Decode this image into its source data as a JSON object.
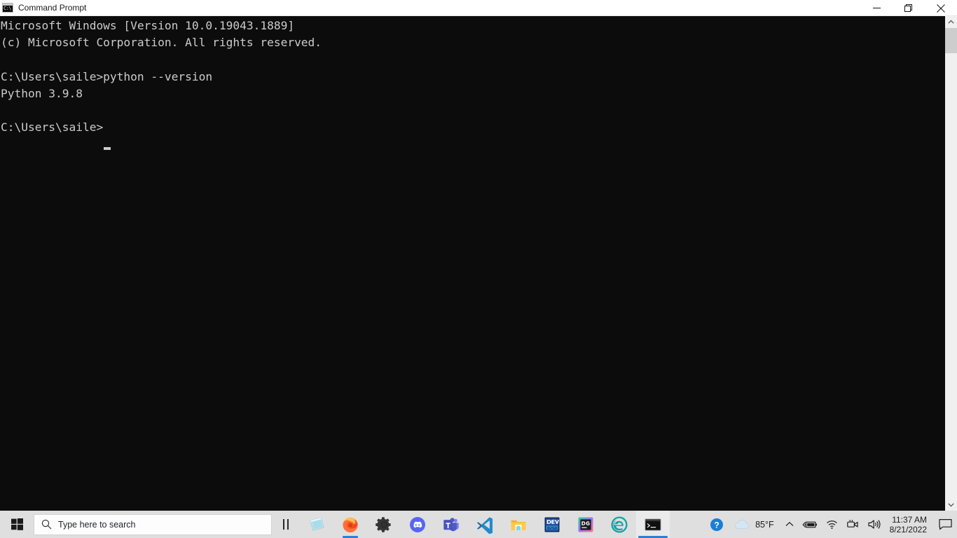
{
  "window": {
    "title": "Command Prompt",
    "icon": "cmd-icon",
    "icon_text": "C:\\",
    "controls": {
      "minimize": "Minimize",
      "restore": "Restore",
      "close": "Close"
    }
  },
  "console": {
    "lines": [
      "Microsoft Windows [Version 10.0.19043.1889]",
      "(c) Microsoft Corporation. All rights reserved.",
      "",
      "C:\\Users\\saile>python --version",
      "Python 3.9.8",
      "",
      "C:\\Users\\saile>"
    ],
    "text": "Microsoft Windows [Version 10.0.19043.1889]\n(c) Microsoft Corporation. All rights reserved.\n\nC:\\Users\\saile>python --version\nPython 3.9.8\n\nC:\\Users\\saile>",
    "prompt": "C:\\Users\\saile>",
    "last_command": "python --version",
    "last_output": "Python 3.9.8",
    "foreground_color": "#cccccc",
    "background_color": "#0c0c0c"
  },
  "scrollbar": {
    "up_arrow": "scroll-up-arrow",
    "down_arrow": "scroll-down-arrow"
  },
  "taskbar": {
    "start": "Start",
    "search": {
      "placeholder": "Type here to search",
      "icon": "search-icon"
    },
    "task_view": "Task View",
    "pinned": [
      {
        "name": "sticky-notes",
        "label": "Sticky Notes",
        "state": "idle"
      },
      {
        "name": "firefox",
        "label": "Firefox",
        "state": "running"
      },
      {
        "name": "settings",
        "label": "Settings",
        "state": "idle"
      },
      {
        "name": "discord",
        "label": "Discord",
        "state": "idle"
      },
      {
        "name": "microsoft-teams",
        "label": "Microsoft Teams",
        "state": "idle"
      },
      {
        "name": "visual-studio-code",
        "label": "Visual Studio Code",
        "state": "idle"
      },
      {
        "name": "file-explorer",
        "label": "File Explorer",
        "state": "idle"
      },
      {
        "name": "dev-cpp",
        "label": "Dev-C++",
        "state": "idle",
        "badge_text": "DEV"
      },
      {
        "name": "datagrip",
        "label": "DataGrip",
        "state": "idle",
        "badge_text": "DG"
      },
      {
        "name": "microsoft-edge",
        "label": "Microsoft Edge",
        "state": "idle"
      },
      {
        "name": "command-prompt",
        "label": "Command Prompt",
        "state": "active"
      }
    ],
    "tray": {
      "help": "Help",
      "weather": {
        "icon": "cloud-icon",
        "temperature": "85°F"
      },
      "show_hidden_icons": "Show hidden icons",
      "battery": "Battery charging",
      "network": "Network",
      "camera": "Camera",
      "volume": "Volume",
      "clock": {
        "time": "11:37 AM",
        "date": "8/21/2022"
      },
      "action_center": "Notifications"
    }
  },
  "colors": {
    "accent": "#2f7fd1",
    "taskbar_bg": "#dfdfdf",
    "console_bg": "#0c0c0c",
    "console_fg": "#cccccc",
    "titlebar_bg": "#ffffff"
  }
}
